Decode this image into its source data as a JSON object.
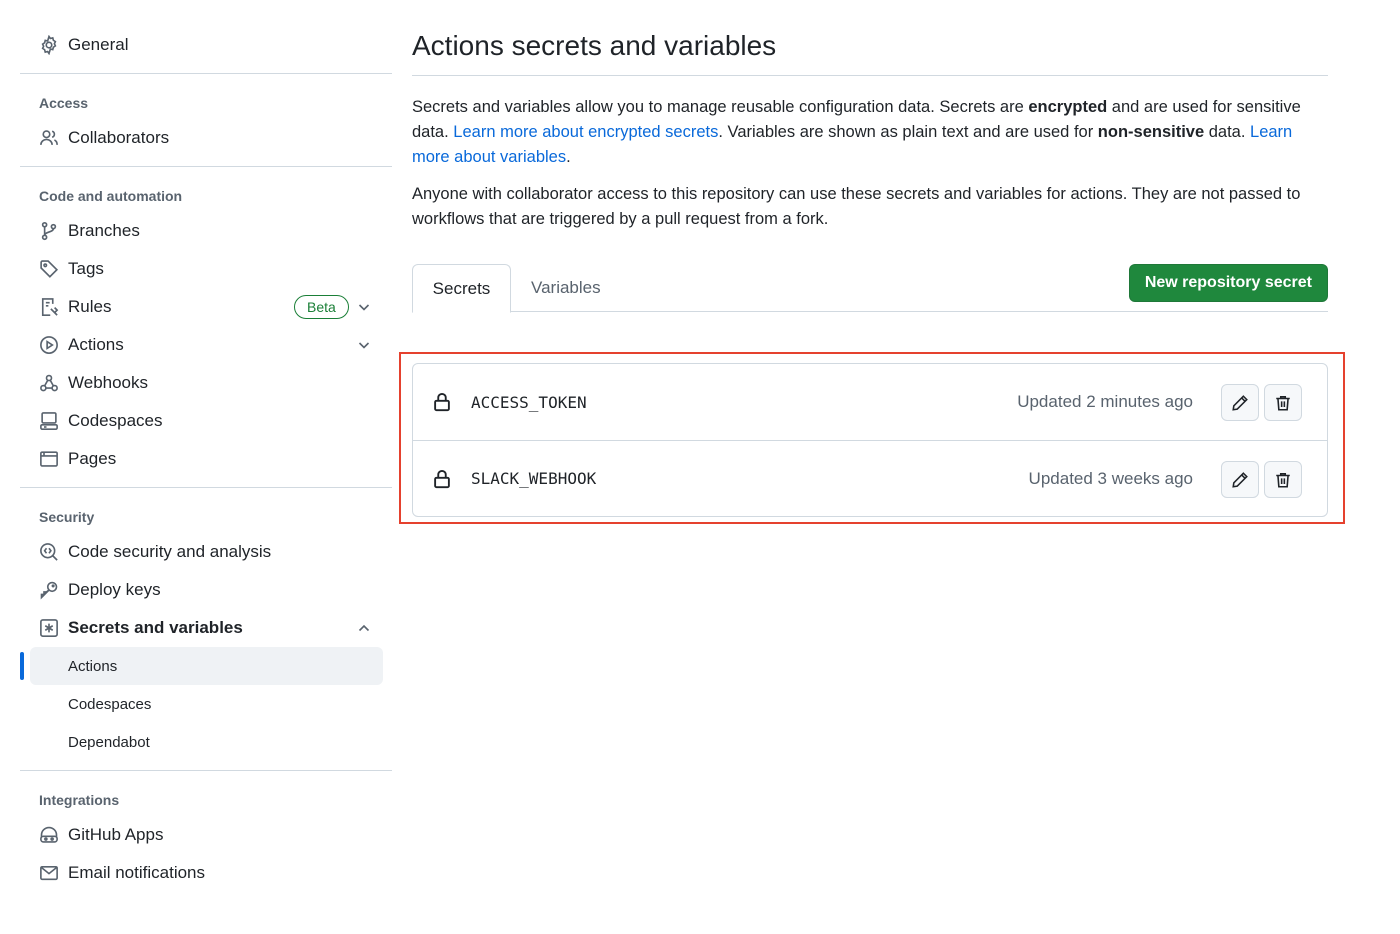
{
  "sidebar": {
    "general": "General",
    "access_title": "Access",
    "collaborators": "Collaborators",
    "code_title": "Code and automation",
    "branches": "Branches",
    "tags": "Tags",
    "rules": "Rules",
    "rules_badge": "Beta",
    "actions": "Actions",
    "webhooks": "Webhooks",
    "codespaces": "Codespaces",
    "pages": "Pages",
    "security_title": "Security",
    "code_security": "Code security and analysis",
    "deploy_keys": "Deploy keys",
    "secrets_vars": "Secrets and variables",
    "sub_actions": "Actions",
    "sub_codespaces": "Codespaces",
    "sub_dependabot": "Dependabot",
    "integrations_title": "Integrations",
    "github_apps": "GitHub Apps",
    "email_notifications": "Email notifications"
  },
  "main": {
    "title": "Actions secrets and variables",
    "p1_a": "Secrets and variables allow you to manage reusable configuration data. Secrets are ",
    "p1_b": "encrypted",
    "p1_c": " and are used for sensitive data. ",
    "p1_link1": "Learn more about encrypted secrets",
    "p1_d": ". Variables are shown as plain text and are used for ",
    "p1_e": "non-sensitive",
    "p1_f": " data. ",
    "p1_link2": "Learn more about variables",
    "p1_g": ".",
    "p2": "Anyone with collaborator access to this repository can use these secrets and variables for actions. They are not passed to workflows that are triggered by a pull request from a fork.",
    "tab_secrets": "Secrets",
    "tab_variables": "Variables",
    "new_secret_button": "New repository secret"
  },
  "secrets": [
    {
      "name": "ACCESS_TOKEN",
      "updated": "Updated 2 minutes ago"
    },
    {
      "name": "SLACK_WEBHOOK",
      "updated": "Updated 3 weeks ago"
    }
  ],
  "colors": {
    "accent": "#0969da",
    "primary_button": "#1f883d",
    "highlight": "#e5412e",
    "badge": "#1a7f37"
  }
}
